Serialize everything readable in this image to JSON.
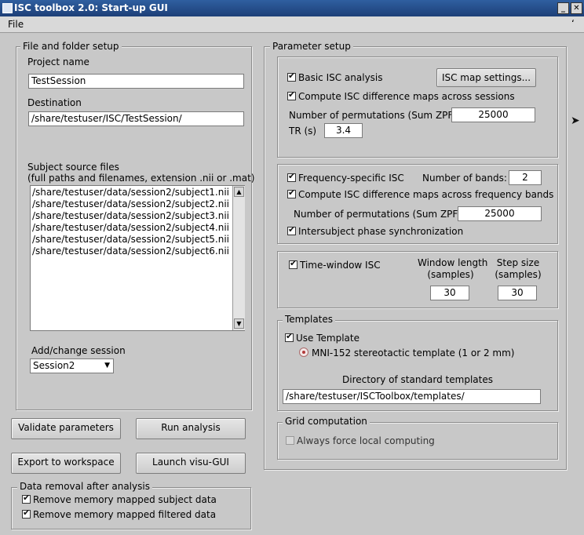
{
  "window": {
    "title": "ISC toolbox 2.0: Start-up GUI",
    "menu_file": "File",
    "menu_right": "ʻ"
  },
  "file_setup": {
    "legend": "File and folder setup",
    "project_label": "Project name",
    "project_value": "TestSession",
    "destination_label": "Destination",
    "destination_value": "/share/testuser/ISC/TestSession/",
    "source_label_1": "Subject source files",
    "source_label_2": "(full paths and filenames, extension .nii or .mat)",
    "source_files": [
      "/share/testuser/data/session2/subject1.nii",
      "/share/testuser/data/session2/subject2.nii",
      "/share/testuser/data/session2/subject3.nii",
      "/share/testuser/data/session2/subject4.nii",
      "/share/testuser/data/session2/subject5.nii",
      "/share/testuser/data/session2/subject6.nii"
    ],
    "session_label": "Add/change session",
    "session_value": "Session2"
  },
  "buttons": {
    "validate": "Validate parameters",
    "run": "Run analysis",
    "export": "Export to workspace",
    "launch": "Launch visu-GUI"
  },
  "data_removal": {
    "legend": "Data removal after analysis",
    "remove_subject": "Remove memory mapped subject data",
    "remove_filtered": "Remove memory mapped filtered data"
  },
  "parameter_setup": {
    "legend": "Parameter setup",
    "basic_isc": "Basic ISC analysis",
    "map_settings": "ISC map settings...",
    "compute_sessions": "Compute ISC difference maps across sessions",
    "permutations_label": "Number of permutations (Sum ZPF)",
    "permutations_value": "25000",
    "tr_label": "TR (s)",
    "tr_value": "3.4",
    "freq_isc": "Frequency-specific ISC",
    "bands_label": "Number of bands:",
    "bands_value": "2",
    "compute_freq": "Compute ISC difference maps across frequency bands",
    "freq_permutations_label": "Number of permutations (Sum ZPF)",
    "freq_permutations_value": "25000",
    "phase_sync": "Intersubject phase synchronization",
    "time_window": "Time-window ISC",
    "window_length_label_1": "Window length",
    "window_length_label_2": "(samples)",
    "window_length_value": "30",
    "step_size_label_1": "Step size",
    "step_size_label_2": "(samples)",
    "step_size_value": "30"
  },
  "templates": {
    "legend": "Templates",
    "use_template": "Use Template",
    "mni": "MNI-152 stereotactic template (1 or 2 mm)",
    "dir_label": "Directory of standard templates",
    "dir_value": "/share/testuser/ISCToolbox/templates/"
  },
  "grid": {
    "legend": "Grid computation",
    "force_local": "Always force local computing"
  }
}
